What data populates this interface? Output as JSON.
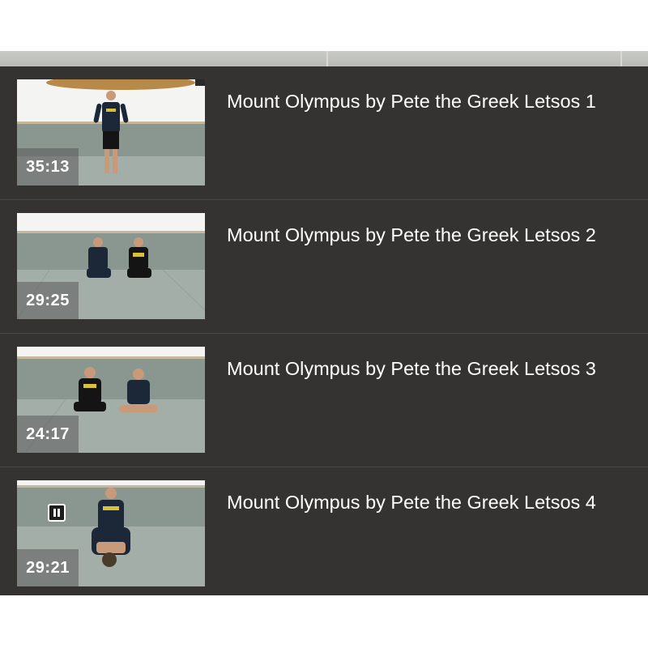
{
  "playlist": {
    "items": [
      {
        "title": "Mount Olympus by Pete the Greek Letsos 1",
        "duration": "35:13",
        "thumbnail": "instructor-standing-alone"
      },
      {
        "title": "Mount Olympus by Pete the Greek Letsos 2",
        "duration": "29:25",
        "thumbnail": "two-men-sitting-on-mat"
      },
      {
        "title": "Mount Olympus by Pete the Greek Letsos 3",
        "duration": "24:17",
        "thumbnail": "two-men-sitting-cross-legged"
      },
      {
        "title": "Mount Olympus by Pete the Greek Letsos 4",
        "duration": "29:21",
        "thumbnail": "instructor-demonstrating-technique",
        "playing": true,
        "control_icon": "pause-icon"
      }
    ]
  },
  "colors": {
    "panel_background": "#353331",
    "divider": "#4a4846",
    "title_text": "#ffffff",
    "duration_overlay": "#5a5a5a"
  }
}
